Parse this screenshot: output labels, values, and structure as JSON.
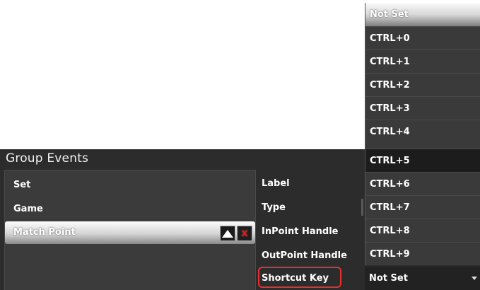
{
  "panel": {
    "title": "Group Events"
  },
  "events": [
    {
      "label": "Set",
      "selected": false
    },
    {
      "label": "Game",
      "selected": false
    },
    {
      "label": "Match Point",
      "selected": true
    }
  ],
  "item_actions": {
    "move_up_icon": "triangle-up-icon",
    "delete_label": "x",
    "delete_color": "#e01818"
  },
  "properties": {
    "label": "Label",
    "type": "Type",
    "inpoint_handle": "InPoint Handle",
    "outpoint_handle": "OutPoint Handle",
    "shortcut_key": "Shortcut Key"
  },
  "highlight_color": "#e53030",
  "shortcut_dropdown": {
    "options": [
      "Not Set",
      "CTRL+0",
      "CTRL+1",
      "CTRL+2",
      "CTRL+3",
      "CTRL+4",
      "CTRL+5",
      "CTRL+6",
      "CTRL+7",
      "CTRL+8",
      "CTRL+9"
    ],
    "selected_value": "Not Set",
    "hovered_option": "CTRL+5"
  }
}
